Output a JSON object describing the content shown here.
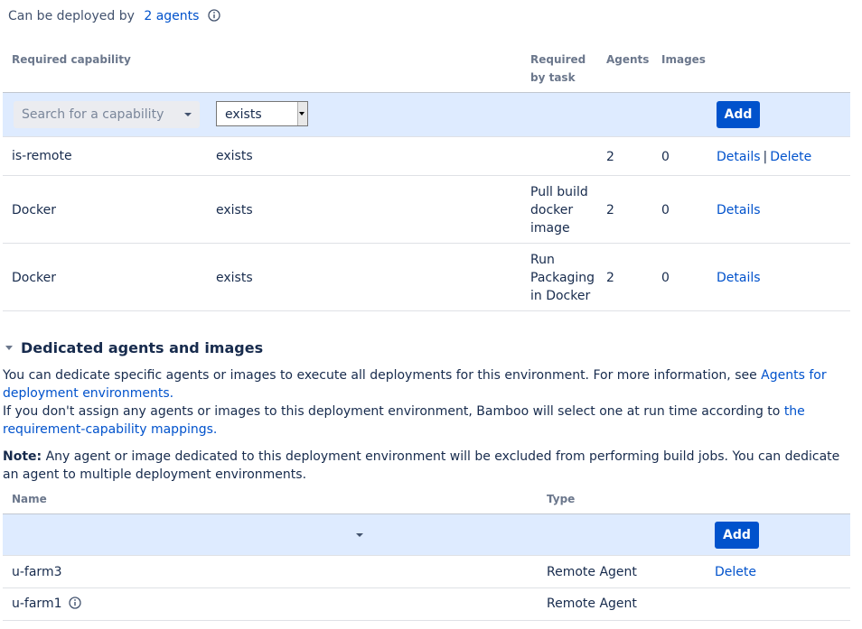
{
  "deploy": {
    "prefix": "Can be deployed by",
    "agents_link": "2 agents"
  },
  "capabilities": {
    "headers": {
      "capability": "Required capability",
      "required_by_task": [
        "Required",
        "by task"
      ],
      "agents": "Agents",
      "images": "Images"
    },
    "search_placeholder": "Search for a capability",
    "condition_value": "exists",
    "add_label": "Add",
    "rows": [
      {
        "capability": "is-remote",
        "condition": "exists",
        "task": [],
        "agents": "2",
        "images": "0",
        "details": "Details",
        "delete": "Delete",
        "sep": "|"
      },
      {
        "capability": "Docker",
        "condition": "exists",
        "task": [
          "Pull build",
          "docker",
          "image"
        ],
        "agents": "2",
        "images": "0",
        "details": "Details"
      },
      {
        "capability": "Docker",
        "condition": "exists",
        "task": [
          "Run",
          "Packaging",
          "in Docker"
        ],
        "agents": "2",
        "images": "0",
        "details": "Details"
      }
    ]
  },
  "dedicated": {
    "title": "Dedicated agents and images",
    "intro": "You can dedicate specific agents or images to execute all deployments for this environment. For more information, see ",
    "intro_link": "Agents for deployment environments.",
    "intro2": "If you don't assign any agents or images to this deployment environment, Bamboo will select one at run time according to ",
    "intro2_link": "the requirement-capability mappings.",
    "note_label": "Note:",
    "note_text": " Any agent or image dedicated to this deployment environment will be excluded from performing build jobs. You can dedicate an agent to multiple deployment environments.",
    "headers": {
      "name": "Name",
      "type": "Type"
    },
    "add_label": "Add",
    "rows": [
      {
        "name": "u-farm3",
        "type": "Remote Agent",
        "delete": "Delete"
      },
      {
        "name": "u-farm1",
        "type": "Remote Agent"
      }
    ]
  },
  "colors": {
    "link": "#0052cc",
    "primary": "#0052cc",
    "add_row_bg": "#deebff",
    "header_text": "#6b778c"
  }
}
